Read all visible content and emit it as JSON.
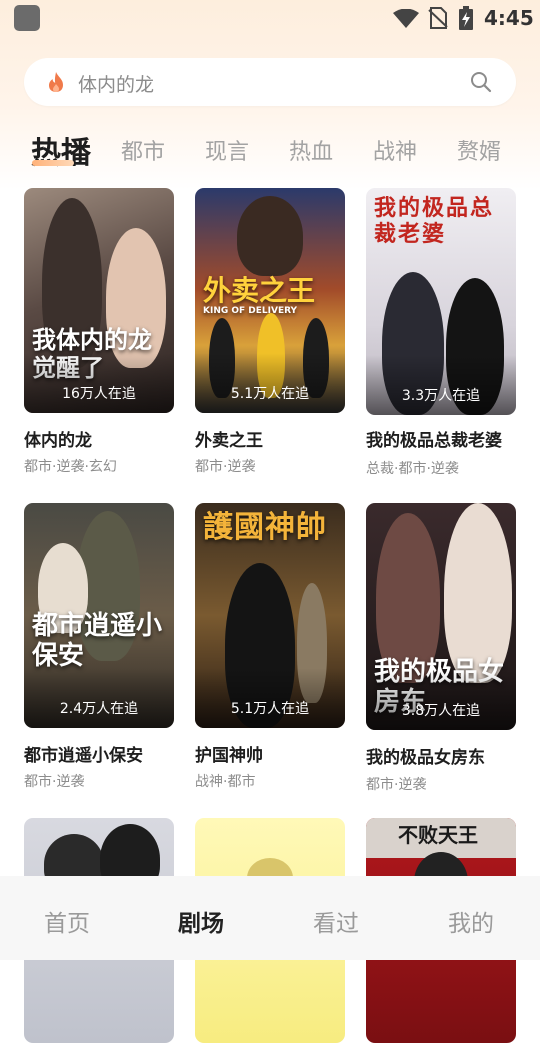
{
  "status_bar": {
    "time": "4:45"
  },
  "search": {
    "placeholder": "体内的龙"
  },
  "tabs": [
    {
      "label": "热播",
      "active": true
    },
    {
      "label": "都市"
    },
    {
      "label": "现言"
    },
    {
      "label": "热血"
    },
    {
      "label": "战神"
    },
    {
      "label": "赘婿"
    }
  ],
  "cards": [
    {
      "title": "体内的龙",
      "tags": "都市·逆袭·玄幻",
      "watching": "16万人在追",
      "poster_text": "我体内的龙觉醒了"
    },
    {
      "title": "外卖之王",
      "tags": "都市·逆袭",
      "watching": "5.1万人在追",
      "poster_text": "外卖之王",
      "poster_subtext": "KING OF DELIVERY"
    },
    {
      "title": "我的极品总裁老婆",
      "tags": "总裁·都市·逆袭",
      "watching": "3.3万人在追",
      "poster_text": "我的极品总裁老婆"
    },
    {
      "title": "都市逍遥小保安",
      "tags": "都市·逆袭",
      "watching": "2.4万人在追",
      "poster_text": "都市逍遥小保安"
    },
    {
      "title": "护国神帅",
      "tags": "战神·都市",
      "watching": "5.1万人在追",
      "poster_text": "護國神帥"
    },
    {
      "title": "我的极品女房东",
      "tags": "都市·逆袭",
      "watching": "3.8万人在追",
      "poster_text": "我的极品女房东"
    },
    {
      "poster_text": "不败天王"
    }
  ],
  "bottom_nav": [
    {
      "label": "首页"
    },
    {
      "label": "剧场",
      "active": true
    },
    {
      "label": "看过"
    },
    {
      "label": "我的"
    }
  ],
  "colors": {
    "accent_gradient_start": "#ffb27a",
    "flame": "#f07a4a",
    "header_wash": "#fdeedd"
  }
}
